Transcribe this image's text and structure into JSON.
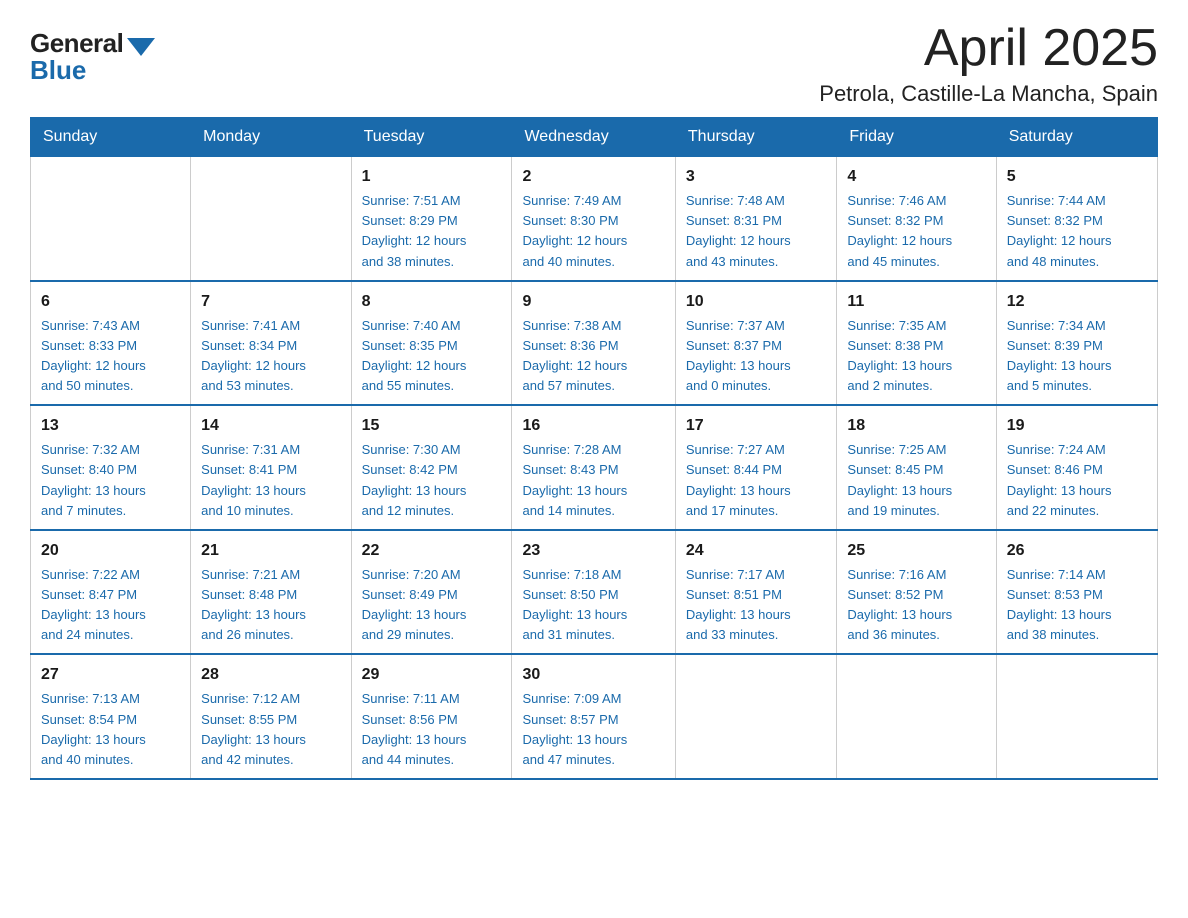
{
  "logo": {
    "general": "General",
    "blue": "Blue"
  },
  "title": "April 2025",
  "subtitle": "Petrola, Castille-La Mancha, Spain",
  "days_of_week": [
    "Sunday",
    "Monday",
    "Tuesday",
    "Wednesday",
    "Thursday",
    "Friday",
    "Saturday"
  ],
  "weeks": [
    [
      {
        "day": "",
        "info": ""
      },
      {
        "day": "",
        "info": ""
      },
      {
        "day": "1",
        "info": "Sunrise: 7:51 AM\nSunset: 8:29 PM\nDaylight: 12 hours\nand 38 minutes."
      },
      {
        "day": "2",
        "info": "Sunrise: 7:49 AM\nSunset: 8:30 PM\nDaylight: 12 hours\nand 40 minutes."
      },
      {
        "day": "3",
        "info": "Sunrise: 7:48 AM\nSunset: 8:31 PM\nDaylight: 12 hours\nand 43 minutes."
      },
      {
        "day": "4",
        "info": "Sunrise: 7:46 AM\nSunset: 8:32 PM\nDaylight: 12 hours\nand 45 minutes."
      },
      {
        "day": "5",
        "info": "Sunrise: 7:44 AM\nSunset: 8:32 PM\nDaylight: 12 hours\nand 48 minutes."
      }
    ],
    [
      {
        "day": "6",
        "info": "Sunrise: 7:43 AM\nSunset: 8:33 PM\nDaylight: 12 hours\nand 50 minutes."
      },
      {
        "day": "7",
        "info": "Sunrise: 7:41 AM\nSunset: 8:34 PM\nDaylight: 12 hours\nand 53 minutes."
      },
      {
        "day": "8",
        "info": "Sunrise: 7:40 AM\nSunset: 8:35 PM\nDaylight: 12 hours\nand 55 minutes."
      },
      {
        "day": "9",
        "info": "Sunrise: 7:38 AM\nSunset: 8:36 PM\nDaylight: 12 hours\nand 57 minutes."
      },
      {
        "day": "10",
        "info": "Sunrise: 7:37 AM\nSunset: 8:37 PM\nDaylight: 13 hours\nand 0 minutes."
      },
      {
        "day": "11",
        "info": "Sunrise: 7:35 AM\nSunset: 8:38 PM\nDaylight: 13 hours\nand 2 minutes."
      },
      {
        "day": "12",
        "info": "Sunrise: 7:34 AM\nSunset: 8:39 PM\nDaylight: 13 hours\nand 5 minutes."
      }
    ],
    [
      {
        "day": "13",
        "info": "Sunrise: 7:32 AM\nSunset: 8:40 PM\nDaylight: 13 hours\nand 7 minutes."
      },
      {
        "day": "14",
        "info": "Sunrise: 7:31 AM\nSunset: 8:41 PM\nDaylight: 13 hours\nand 10 minutes."
      },
      {
        "day": "15",
        "info": "Sunrise: 7:30 AM\nSunset: 8:42 PM\nDaylight: 13 hours\nand 12 minutes."
      },
      {
        "day": "16",
        "info": "Sunrise: 7:28 AM\nSunset: 8:43 PM\nDaylight: 13 hours\nand 14 minutes."
      },
      {
        "day": "17",
        "info": "Sunrise: 7:27 AM\nSunset: 8:44 PM\nDaylight: 13 hours\nand 17 minutes."
      },
      {
        "day": "18",
        "info": "Sunrise: 7:25 AM\nSunset: 8:45 PM\nDaylight: 13 hours\nand 19 minutes."
      },
      {
        "day": "19",
        "info": "Sunrise: 7:24 AM\nSunset: 8:46 PM\nDaylight: 13 hours\nand 22 minutes."
      }
    ],
    [
      {
        "day": "20",
        "info": "Sunrise: 7:22 AM\nSunset: 8:47 PM\nDaylight: 13 hours\nand 24 minutes."
      },
      {
        "day": "21",
        "info": "Sunrise: 7:21 AM\nSunset: 8:48 PM\nDaylight: 13 hours\nand 26 minutes."
      },
      {
        "day": "22",
        "info": "Sunrise: 7:20 AM\nSunset: 8:49 PM\nDaylight: 13 hours\nand 29 minutes."
      },
      {
        "day": "23",
        "info": "Sunrise: 7:18 AM\nSunset: 8:50 PM\nDaylight: 13 hours\nand 31 minutes."
      },
      {
        "day": "24",
        "info": "Sunrise: 7:17 AM\nSunset: 8:51 PM\nDaylight: 13 hours\nand 33 minutes."
      },
      {
        "day": "25",
        "info": "Sunrise: 7:16 AM\nSunset: 8:52 PM\nDaylight: 13 hours\nand 36 minutes."
      },
      {
        "day": "26",
        "info": "Sunrise: 7:14 AM\nSunset: 8:53 PM\nDaylight: 13 hours\nand 38 minutes."
      }
    ],
    [
      {
        "day": "27",
        "info": "Sunrise: 7:13 AM\nSunset: 8:54 PM\nDaylight: 13 hours\nand 40 minutes."
      },
      {
        "day": "28",
        "info": "Sunrise: 7:12 AM\nSunset: 8:55 PM\nDaylight: 13 hours\nand 42 minutes."
      },
      {
        "day": "29",
        "info": "Sunrise: 7:11 AM\nSunset: 8:56 PM\nDaylight: 13 hours\nand 44 minutes."
      },
      {
        "day": "30",
        "info": "Sunrise: 7:09 AM\nSunset: 8:57 PM\nDaylight: 13 hours\nand 47 minutes."
      },
      {
        "day": "",
        "info": ""
      },
      {
        "day": "",
        "info": ""
      },
      {
        "day": "",
        "info": ""
      }
    ]
  ]
}
